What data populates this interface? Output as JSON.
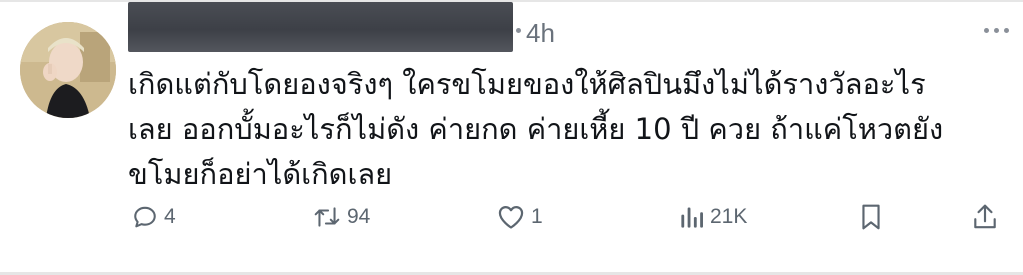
{
  "tweet": {
    "time": "4h",
    "text_lines": [
      "เกิดแต่กับโดยองจริงๆ ใครขโมยของให้ศิลปินมึงไม่ได้รางวัลอะไร",
      "เลย ออกบั้มอะไรก็ไม่ดัง ค่ายกด ค่ายเหี้ย 10 ปี ควย ถ้าแค่โหวตยัง",
      "ขโมยก็อย่าได้เกิดเลย"
    ]
  },
  "actions": {
    "replies": "4",
    "retweets": "94",
    "likes": "1",
    "views": "21K"
  },
  "icons": {
    "reply": "reply-icon",
    "retweet": "retweet-icon",
    "like": "heart-icon",
    "views": "views-icon",
    "bookmark": "bookmark-icon",
    "share": "share-icon",
    "more": "more-icon"
  },
  "colors": {
    "text": "#111418",
    "muted": "#5c6670",
    "redaction": "#43464d"
  }
}
